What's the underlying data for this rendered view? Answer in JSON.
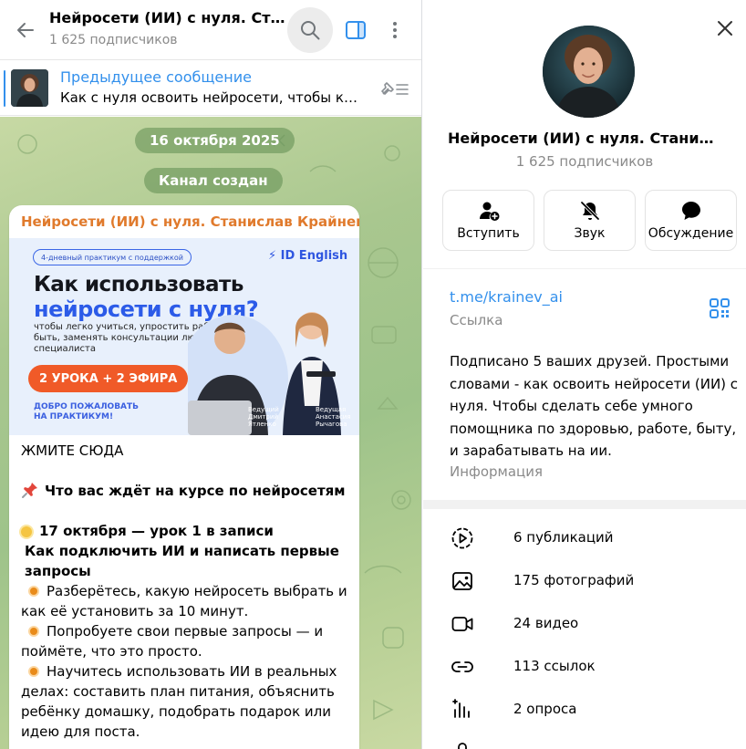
{
  "chat": {
    "title": "Нейросети (ИИ) с нуля. Станислав Крайнев",
    "subscribers": "1 625 подписчиков",
    "pinned": {
      "title": "Предыдущее сообщение",
      "text": "Как с нуля освоить нейросети, чтобы ко..."
    },
    "date_pill": "16 октября 2025",
    "created_pill": "Канал создан",
    "message": {
      "author": "Нейросети (ИИ) с нуля. Станислав Крайнев",
      "promo": {
        "tag": "4-дневный практикум с поддержкой",
        "brand": "ID English",
        "headline_1": "Как использовать",
        "headline_2": "нейросети с нуля?",
        "description": "чтобы легко учиться, упростить работу и быть, заменять консультации любого специалиста",
        "cta": "2 УРОКА + 2 ЭФИРА",
        "welcome": "ДОБРО ПОЖАЛОВАТЬ НА ПРАКТИКУМ!",
        "host_1_role": "Ведущий",
        "host_1_name": "Дмитрий Ятленко",
        "host_2_role": "Ведущая",
        "host_2_name": "Анастасия Рычагова"
      },
      "line_1": "ЖМИТЕ СЮДА",
      "line_2": "Что вас ждёт на курсе по нейросетям",
      "line_3": "17 октября — урок 1 в записи",
      "line_4": "Как подключить ИИ и написать первые запросы",
      "bullet_1": "Разберётесь, какую нейросеть выбрать и как её установить за 10 минут.",
      "bullet_2": "Попробуете свои первые запросы — и поймёте, что это просто.",
      "bullet_3": "Научитесь использовать ИИ в реальных делах: составить план питания, объяснить ребёнку домашку, подобрать подарок или идею для поста."
    }
  },
  "info": {
    "title": "Нейросети (ИИ) с нуля. Станислав Крайнев",
    "subscribers": "1 625 подписчиков",
    "actions": [
      {
        "label": "Вступить",
        "icon": "join-icon"
      },
      {
        "label": "Звук",
        "icon": "mute-bell-icon"
      },
      {
        "label": "Обсуждение",
        "icon": "chat-bubble-icon"
      }
    ],
    "link": "t.me/krainev_ai",
    "link_label": "Ссылка",
    "about": "Подписано 5 ваших друзей. Простыми словами - как освоить нейросети (ИИ) с нуля. Чтобы сделать себе умного помощника по здоровью, работе, быту, и зарабатывать на ии.",
    "about_label": "Информация",
    "media": [
      {
        "label": "6 публикаций",
        "icon": "stories-icon"
      },
      {
        "label": "175 фотографий",
        "icon": "photo-icon"
      },
      {
        "label": "24 видео",
        "icon": "video-icon"
      },
      {
        "label": "113 ссылок",
        "icon": "link-icon"
      },
      {
        "label": "2 опроса",
        "icon": "poll-icon"
      }
    ]
  },
  "colors": {
    "accent": "#3390ec",
    "author": "#e07a2c",
    "wallpaper": "#a9c78f",
    "secondary_text": "#8a8a8a"
  }
}
